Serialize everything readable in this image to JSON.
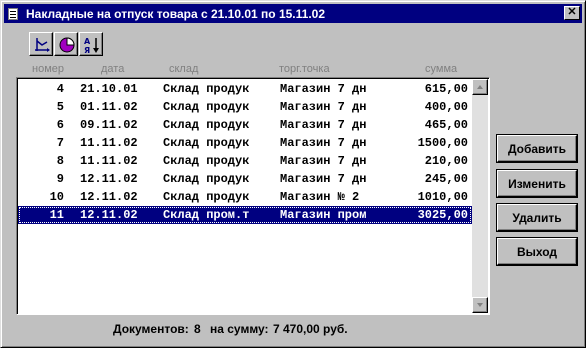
{
  "window": {
    "title": "Накладные на отпуск товара с 21.10.01 по 15.11.02",
    "close_glyph": "✕"
  },
  "toolbar": {
    "buttons": [
      {
        "name": "axis-chart-icon"
      },
      {
        "name": "pie-chart-icon"
      },
      {
        "name": "sort-az-icon"
      }
    ]
  },
  "columns": {
    "num": "номер",
    "date": "дата",
    "warehouse": "склад",
    "store": "торг.точка",
    "sum": "сумма"
  },
  "rows": [
    {
      "num": "4",
      "date": "21.10.01",
      "warehouse": "Склад продук",
      "store": "Магазин 7 дн",
      "sum": "615,00"
    },
    {
      "num": "5",
      "date": "01.11.02",
      "warehouse": "Склад продук",
      "store": "Магазин 7 дн",
      "sum": "400,00"
    },
    {
      "num": "6",
      "date": "09.11.02",
      "warehouse": "Склад продук",
      "store": "Магазин 7 дн",
      "sum": "465,00"
    },
    {
      "num": "7",
      "date": "11.11.02",
      "warehouse": "Склад продук",
      "store": "Магазин 7 дн",
      "sum": "1500,00"
    },
    {
      "num": "8",
      "date": "11.11.02",
      "warehouse": "Склад продук",
      "store": "Магазин 7 дн",
      "sum": "210,00"
    },
    {
      "num": "9",
      "date": "12.11.02",
      "warehouse": "Склад продук",
      "store": "Магазин 7 дн",
      "sum": "245,00"
    },
    {
      "num": "10",
      "date": "12.11.02",
      "warehouse": "Склад продук",
      "store": "Магазин № 2",
      "sum": "1010,00"
    },
    {
      "num": "11",
      "date": "12.11.02",
      "warehouse": "Склад пром.т",
      "store": "Магазин пром",
      "sum": "3025,00",
      "selected": true
    }
  ],
  "buttons": {
    "add": "Добавить",
    "edit": "Изменить",
    "delete": "Удалить",
    "exit": "Выход"
  },
  "status": {
    "docs_label": "Документов:",
    "docs_count": "8",
    "sum_label": "на сумму:",
    "sum_value": "7 470,00 руб."
  },
  "colors": {
    "title_bar": "#000080",
    "selection": "#000080",
    "face": "#c0c0c0"
  }
}
